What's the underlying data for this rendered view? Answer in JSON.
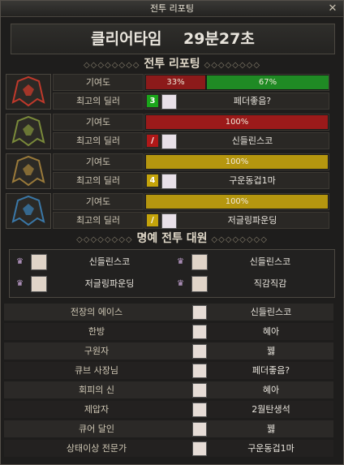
{
  "window": {
    "title": "전투 리포팅",
    "close_glyph": "✕"
  },
  "clear_time": {
    "label": "클리어타임",
    "value": "29분27초"
  },
  "report": {
    "section_title": "전투 리포팅",
    "contrib_label": "기여도",
    "dealer_label": "최고의 딜러",
    "rows": [
      {
        "helmet_color": "#c0392b",
        "segments": [
          {
            "text": "33%",
            "pct": 33,
            "color": "#8c1a1a"
          },
          {
            "text": "67%",
            "pct": 67,
            "color": "#1f8a24"
          }
        ],
        "dealer_number": "3",
        "dealer_number_color": "#1aa51a",
        "dealer_name": "페더좋음?"
      },
      {
        "helmet_color": "#7a8a3a",
        "segments": [
          {
            "text": "100%",
            "pct": 100,
            "color": "#9b1a1a"
          }
        ],
        "dealer_number": "/",
        "dealer_number_color": "#b01818",
        "dealer_name": "신들린스코"
      },
      {
        "helmet_color": "#9a7a3a",
        "segments": [
          {
            "text": "100%",
            "pct": 100,
            "color": "#b5960f"
          }
        ],
        "dealer_number": "4",
        "dealer_number_color": "#c4a30a",
        "dealer_name": "구운동겁1마"
      },
      {
        "helmet_color": "#3a78a8",
        "segments": [
          {
            "text": "100%",
            "pct": 100,
            "color": "#b5960f"
          }
        ],
        "dealer_number": "/",
        "dealer_number_color": "#c4a30a",
        "dealer_name": "저글링파운딩"
      }
    ]
  },
  "honor": {
    "section_title": "명예 전투 대원",
    "members": [
      "신들린스코",
      "신들린스코",
      "저글링파운딩",
      "직감직감"
    ]
  },
  "awards": [
    {
      "title": "전장의 에이스",
      "name": "신들린스코"
    },
    {
      "title": "한방",
      "name": "혜아"
    },
    {
      "title": "구원자",
      "name": "꿿"
    },
    {
      "title": "큐브 사장님",
      "name": "페더좋음?"
    },
    {
      "title": "회피의 신",
      "name": "혜아"
    },
    {
      "title": "제압자",
      "name": "2월탄생석"
    },
    {
      "title": "큐어 달인",
      "name": "꿿"
    },
    {
      "title": "상태이상 전문가",
      "name": "구운동겁1마"
    }
  ]
}
